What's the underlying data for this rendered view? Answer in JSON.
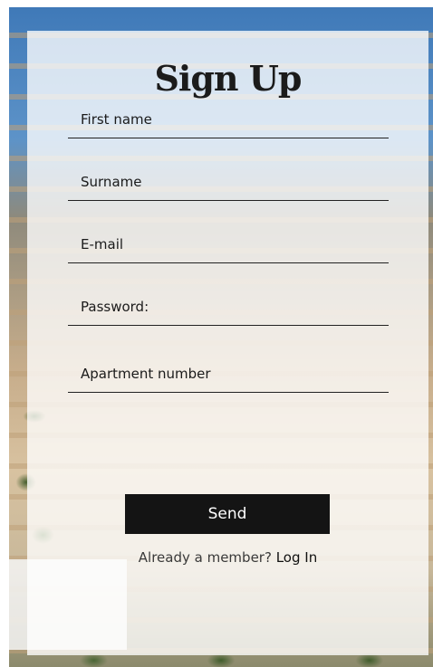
{
  "form": {
    "title": "Sign Up",
    "fields": [
      {
        "placeholder": "First name",
        "value": ""
      },
      {
        "placeholder": "Surname",
        "value": ""
      },
      {
        "placeholder": "E-mail",
        "value": ""
      },
      {
        "placeholder": "Password:",
        "value": ""
      },
      {
        "placeholder": "Apartment number",
        "value": ""
      }
    ],
    "submit_label": "Send",
    "member_prompt": "Already a member?",
    "login_link": "Log In"
  },
  "colors": {
    "button_bg": "#141414",
    "button_text": "#ffffff",
    "text": "#1b1b1b",
    "card_bg": "rgba(255,255,255,0.78)"
  }
}
